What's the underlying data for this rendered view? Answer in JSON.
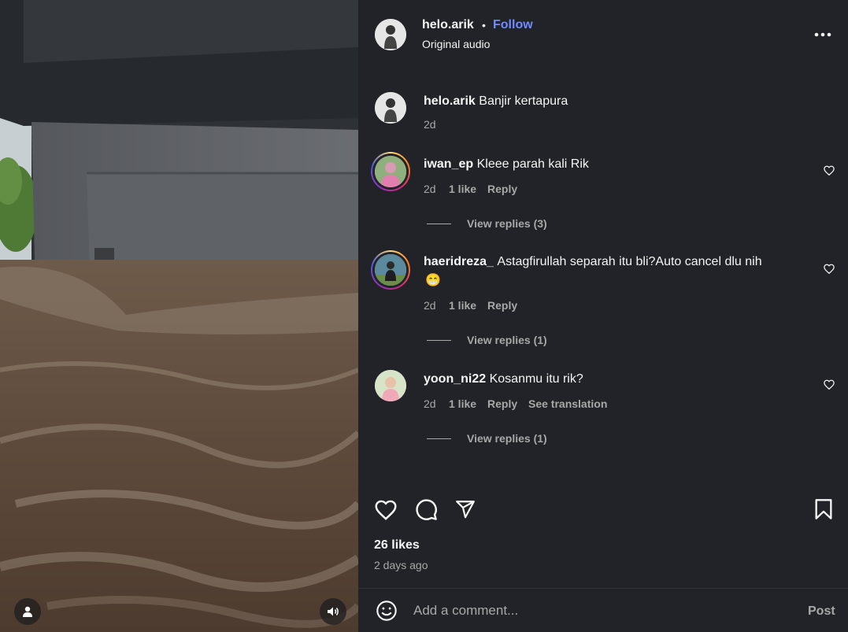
{
  "post": {
    "author": "helo.arik",
    "separator": "•",
    "follow_label": "Follow",
    "audio": "Original audio",
    "more_icon": "more-horizontal-icon"
  },
  "caption": {
    "username": "helo.arik",
    "text": "Banjir kertapura",
    "time": "2d"
  },
  "comments": [
    {
      "username": "iwan_ep",
      "text": "Kleee parah kali Rik",
      "time": "2d",
      "likes": "1 like",
      "reply": "Reply",
      "view_replies": "View replies (3)"
    },
    {
      "username": "haeridreza_",
      "text": "Astagfirullah separah itu bli?Auto cancel dlu nih",
      "emoji": "😁",
      "time": "2d",
      "likes": "1 like",
      "reply": "Reply",
      "view_replies": "View replies (1)"
    },
    {
      "username": "yoon_ni22",
      "text": "Kosanmu itu rik?",
      "time": "2d",
      "likes": "1 like",
      "reply": "Reply",
      "translation": "See translation",
      "view_replies": "View replies (1)"
    }
  ],
  "actions": {
    "like_icon": "heart-icon",
    "comment_icon": "comment-icon",
    "share_icon": "share-icon",
    "save_icon": "bookmark-icon"
  },
  "stats": {
    "likes": "26 likes",
    "posted": "2 days ago"
  },
  "comment_box": {
    "emoji_icon": "emoji-icon",
    "placeholder": "Add a comment...",
    "post_label": "Post"
  },
  "colors": {
    "panel_bg": "#212328",
    "follow_blue": "#708bff",
    "muted_text": "#a8a8a8"
  }
}
